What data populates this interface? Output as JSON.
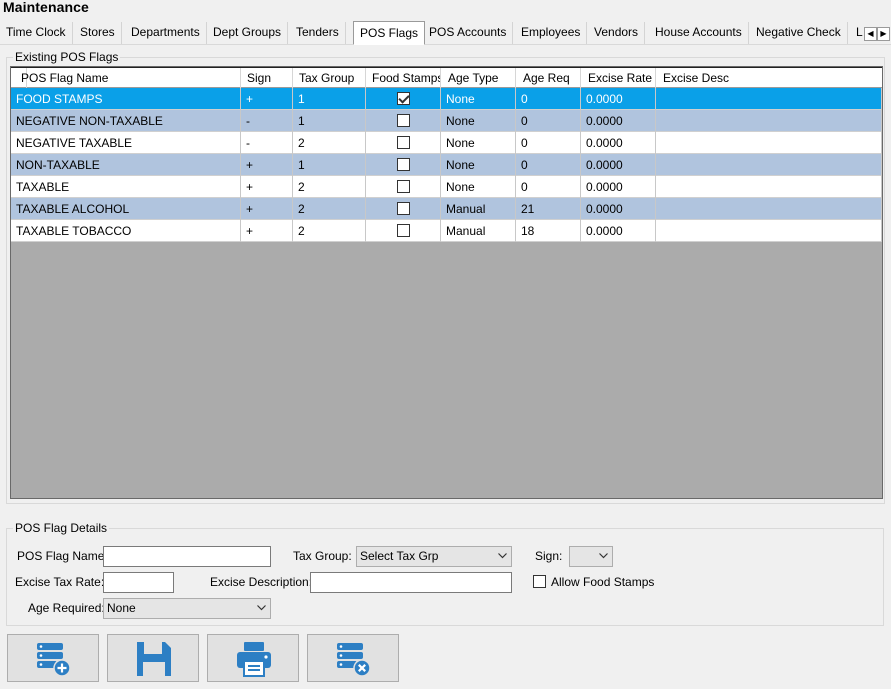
{
  "window": {
    "title": "Maintenance"
  },
  "tabs": [
    {
      "label": "Time Clock"
    },
    {
      "label": "Stores"
    },
    {
      "label": "Departments"
    },
    {
      "label": "Dept Groups"
    },
    {
      "label": "Tenders"
    },
    {
      "label": "POS Flags",
      "active": true
    },
    {
      "label": "POS Accounts"
    },
    {
      "label": "Employees"
    },
    {
      "label": "Vendors"
    },
    {
      "label": "House Accounts"
    },
    {
      "label": "Negative Check"
    },
    {
      "label": "L"
    }
  ],
  "tab_scroll": {
    "left_icon": "arrow-left-icon",
    "right_icon": "arrow-right-icon"
  },
  "existing_group": {
    "label": "Existing POS Flags",
    "columns": [
      "POS Flag Name",
      "Sign",
      "Tax Group",
      "Food Stamps",
      "Age Type",
      "Age Req",
      "Excise Rate",
      "Excise Desc"
    ],
    "rows": [
      {
        "name": "FOOD STAMPS",
        "sign": "+",
        "tax_group": "1",
        "food_stamps": true,
        "age_type": "None",
        "age_req": "0",
        "excise_rate": "0.0000",
        "excise_desc": "",
        "selected": true
      },
      {
        "name": "NEGATIVE NON-TAXABLE",
        "sign": "-",
        "tax_group": "1",
        "food_stamps": false,
        "age_type": "None",
        "age_req": "0",
        "excise_rate": "0.0000",
        "excise_desc": ""
      },
      {
        "name": "NEGATIVE TAXABLE",
        "sign": "-",
        "tax_group": "2",
        "food_stamps": false,
        "age_type": "None",
        "age_req": "0",
        "excise_rate": "0.0000",
        "excise_desc": ""
      },
      {
        "name": "NON-TAXABLE",
        "sign": "+",
        "tax_group": "1",
        "food_stamps": false,
        "age_type": "None",
        "age_req": "0",
        "excise_rate": "0.0000",
        "excise_desc": ""
      },
      {
        "name": "TAXABLE",
        "sign": "+",
        "tax_group": "2",
        "food_stamps": false,
        "age_type": "None",
        "age_req": "0",
        "excise_rate": "0.0000",
        "excise_desc": ""
      },
      {
        "name": "TAXABLE ALCOHOL",
        "sign": "+",
        "tax_group": "2",
        "food_stamps": false,
        "age_type": "Manual",
        "age_req": "21",
        "excise_rate": "0.0000",
        "excise_desc": ""
      },
      {
        "name": "TAXABLE TOBACCO",
        "sign": "+",
        "tax_group": "2",
        "food_stamps": false,
        "age_type": "Manual",
        "age_req": "18",
        "excise_rate": "0.0000",
        "excise_desc": ""
      }
    ]
  },
  "details": {
    "label": "POS Flag Details",
    "flag_name_label": "POS Flag Name:",
    "flag_name_value": "",
    "tax_group_label": "Tax Group:",
    "tax_group_value": "Select Tax Grp",
    "sign_label": "Sign:",
    "sign_value": "",
    "excise_rate_label": "Excise Tax Rate:",
    "excise_rate_value": "",
    "excise_desc_label": "Excise Description:",
    "excise_desc_value": "",
    "allow_food_stamps_label": "Allow Food Stamps",
    "allow_food_stamps_checked": false,
    "age_required_label": "Age Required:",
    "age_required_value": "None"
  },
  "buttons": [
    {
      "icon": "database-add-icon"
    },
    {
      "icon": "save-floppy-icon"
    },
    {
      "icon": "printer-icon"
    },
    {
      "icon": "database-delete-icon"
    }
  ],
  "colors": {
    "selected_row": "#0aa0e8",
    "alt_row": "#b0c4de",
    "grid_background": "#ababab",
    "icon_blue": "#2d7fc4"
  }
}
